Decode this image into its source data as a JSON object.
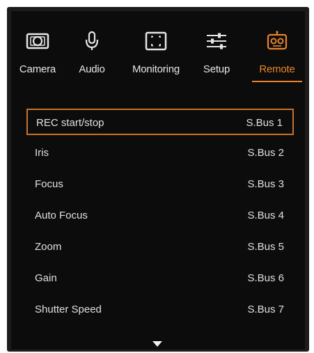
{
  "tabs": [
    {
      "label": "Camera",
      "icon": "camera-icon",
      "active": false
    },
    {
      "label": "Audio",
      "icon": "microphone-icon",
      "active": false
    },
    {
      "label": "Monitoring",
      "icon": "monitor-frame-icon",
      "active": false
    },
    {
      "label": "Setup",
      "icon": "sliders-icon",
      "active": false
    },
    {
      "label": "Remote",
      "icon": "remote-icon",
      "active": true
    }
  ],
  "rows": [
    {
      "function": "REC start/stop",
      "bus": "S.Bus 1",
      "selected": true
    },
    {
      "function": "Iris",
      "bus": "S.Bus 2",
      "selected": false
    },
    {
      "function": "Focus",
      "bus": "S.Bus 3",
      "selected": false
    },
    {
      "function": "Auto Focus",
      "bus": "S.Bus 4",
      "selected": false
    },
    {
      "function": "Zoom",
      "bus": "S.Bus 5",
      "selected": false
    },
    {
      "function": "Gain",
      "bus": "S.Bus 6",
      "selected": false
    },
    {
      "function": "Shutter Speed",
      "bus": "S.Bus 7",
      "selected": false
    }
  ],
  "colors": {
    "accent": "#e8842c",
    "background": "#0c0c0c",
    "text": "#e0e0e0"
  },
  "scroll_indicator_icon": "chevron-down-icon"
}
